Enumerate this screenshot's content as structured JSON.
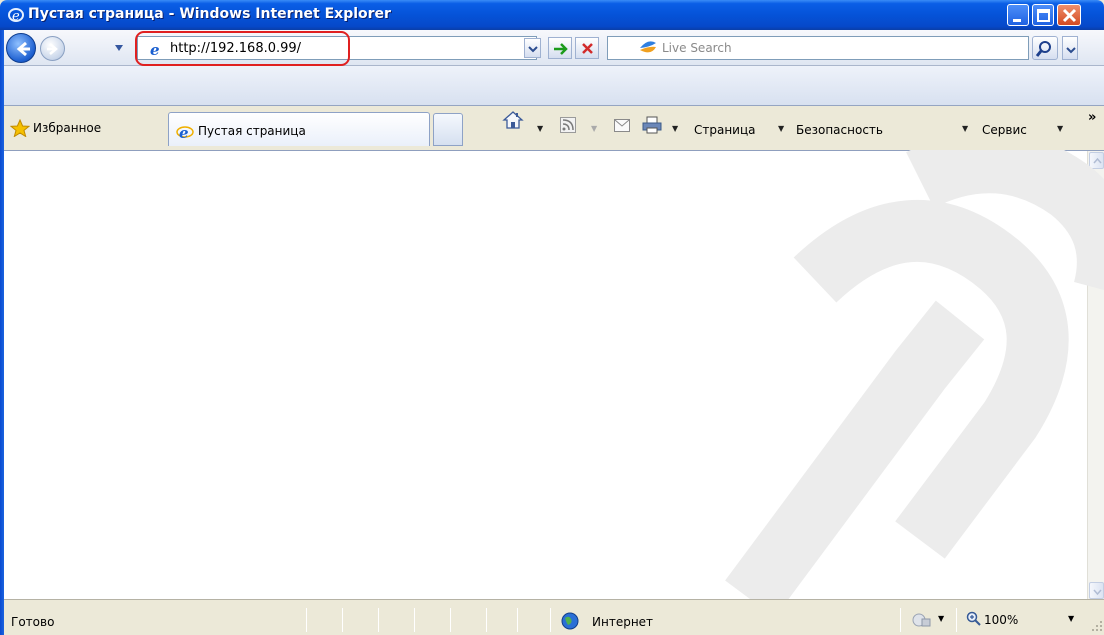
{
  "window": {
    "title": "Пустая страница - Windows Internet Explorer"
  },
  "address_bar": {
    "url": "http://192.168.0.99/",
    "highlight_color": "#e02020"
  },
  "search": {
    "placeholder": "Live Search"
  },
  "favorites": {
    "label": "Избранное"
  },
  "tabs": [
    {
      "label": "Пустая страница",
      "active": true
    }
  ],
  "command_bar": {
    "page_label": "Страница",
    "safety_label": "Безопасность",
    "tools_label": "Сервис"
  },
  "status_bar": {
    "status_text": "Готово",
    "zone_text": "Интернет",
    "zoom_text": "100%"
  },
  "icons": {
    "title": "ie-logo-icon",
    "back": "back-arrow-icon",
    "forward": "forward-arrow-icon",
    "go": "go-arrow-icon",
    "stop": "stop-x-icon",
    "search": "magnifier-icon",
    "favorites": "star-icon",
    "home": "home-icon",
    "feeds": "rss-icon",
    "mail": "mail-icon",
    "print": "printer-icon",
    "zone": "globe-icon",
    "zoom": "zoom-icon"
  },
  "colors": {
    "titlebar": "#0553d8",
    "watermark": "#ececec"
  }
}
